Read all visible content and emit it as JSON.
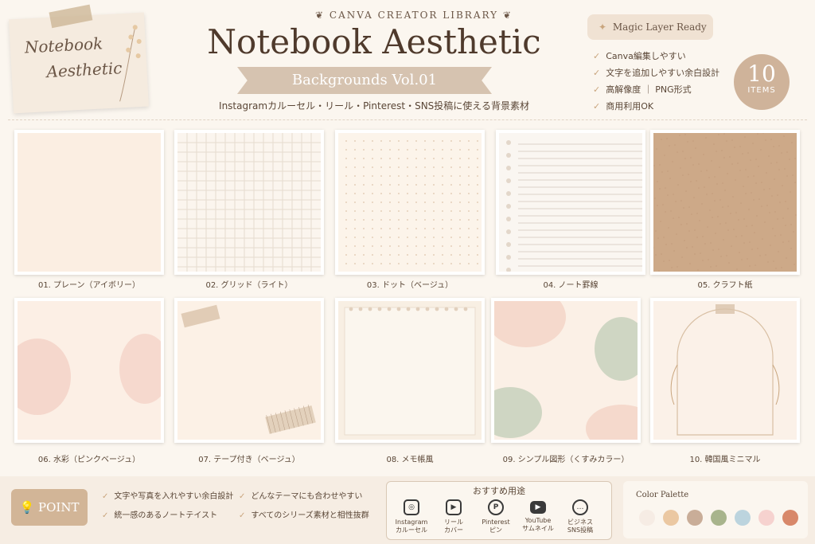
{
  "header": {
    "note_line1": "Notebook",
    "note_line2": "Aesthetic",
    "brand": "CANVA CREATOR LIBRARY",
    "title": "Notebook Aesthetic",
    "ribbon": "Backgrounds Vol.01",
    "subtitle": "Instagramカルーセル・リール・Pinterest・SNS投稿に使える背景素材",
    "magic": "Magic Layer Ready",
    "features": [
      "Canva編集しやすい",
      "文字を追加しやすい余白設計",
      "高解像度 ｜ PNG形式",
      "商用利用OK"
    ],
    "badge_number": "10",
    "badge_label": "ITEMS"
  },
  "items": [
    {
      "label": "01. プレーン（アイボリー）",
      "style": "plain",
      "color": "#fbeee2"
    },
    {
      "label": "02. グリッド（ライト）",
      "style": "grid",
      "color": "#fbf5ee"
    },
    {
      "label": "03. ドット（ベージュ）",
      "style": "dot",
      "color": "#fcf4ea"
    },
    {
      "label": "04. ノート罫線",
      "style": "lined",
      "color": "#faf6f1"
    },
    {
      "label": "05. クラフト紙",
      "style": "kraft",
      "color": "#cda988"
    },
    {
      "label": "06. 水彩（ピンクベージュ）",
      "style": "watercolor",
      "color": "#fcefe5"
    },
    {
      "label": "07. テープ付き（ベージュ）",
      "style": "tape",
      "color": "#fcf1e6"
    },
    {
      "label": "08. メモ帳風",
      "style": "memo",
      "color": "#f8efe3"
    },
    {
      "label": "09. シンプル図形（くすみカラー）",
      "style": "shapes",
      "color": "#fbf0e6"
    },
    {
      "label": "10. 韓国風ミニマル",
      "style": "arch",
      "color": "#fbf1e8"
    }
  ],
  "point": {
    "label": "POINT",
    "items": [
      "文字や写真を入れやすい余白設計",
      "どんなテーマにも合わせやすい",
      "統一感のあるノートテイスト",
      "すべてのシリーズ素材と相性抜群"
    ]
  },
  "uses": {
    "title": "おすすめ用途",
    "items": [
      {
        "icon": "instagram-icon",
        "line1": "Instagram",
        "line2": "カルーセル"
      },
      {
        "icon": "reel-icon",
        "line1": "リール",
        "line2": "カバー"
      },
      {
        "icon": "pinterest-icon",
        "line1": "Pinterest",
        "line2": "ピン"
      },
      {
        "icon": "youtube-icon",
        "line1": "YouTube",
        "line2": "サムネイル"
      },
      {
        "icon": "chat-icon",
        "line1": "ビジネス",
        "line2": "SNS投稿"
      }
    ]
  },
  "palette": {
    "title": "Color Palette",
    "colors": [
      "#f6ece4",
      "#ebc8a2",
      "#c9ad98",
      "#a8b48c",
      "#bcd4de",
      "#f6d2cf",
      "#d8886a"
    ]
  }
}
